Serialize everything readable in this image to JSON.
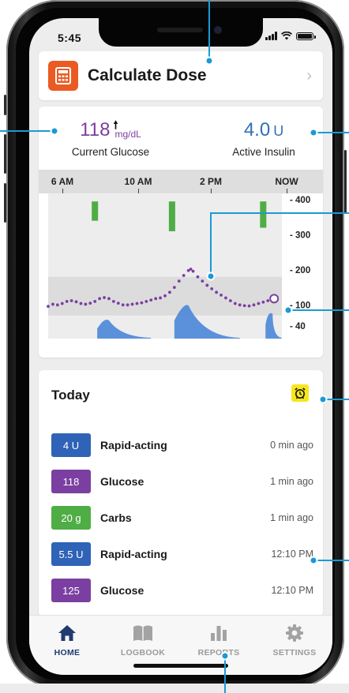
{
  "status_bar": {
    "time": "5:45"
  },
  "dose": {
    "title": "Calculate Dose",
    "icon": "calculator-icon"
  },
  "glucose": {
    "value": "118",
    "unit": "mg/dL",
    "trend": "rising-arrow-icon",
    "label": "Current Glucose"
  },
  "insulin": {
    "value": "4.0",
    "unit": "U",
    "label": "Active Insulin"
  },
  "chart_data": {
    "type": "line",
    "x_labels": [
      "6 AM",
      "10 AM",
      "2 PM",
      "NOW"
    ],
    "y_ticks": [
      "400",
      "300",
      "200",
      "100",
      "40"
    ],
    "ylim": [
      40,
      400
    ],
    "target_range": [
      70,
      180
    ],
    "glucose_series": [
      [
        0,
        96
      ],
      [
        0.02,
        102
      ],
      [
        0.04,
        100
      ],
      [
        0.06,
        104
      ],
      [
        0.08,
        110
      ],
      [
        0.1,
        112
      ],
      [
        0.12,
        109
      ],
      [
        0.14,
        104
      ],
      [
        0.16,
        102
      ],
      [
        0.18,
        105
      ],
      [
        0.2,
        110
      ],
      [
        0.22,
        118
      ],
      [
        0.24,
        121
      ],
      [
        0.26,
        118
      ],
      [
        0.28,
        110
      ],
      [
        0.3,
        105
      ],
      [
        0.32,
        100
      ],
      [
        0.34,
        100
      ],
      [
        0.36,
        102
      ],
      [
        0.38,
        104
      ],
      [
        0.4,
        106
      ],
      [
        0.42,
        110
      ],
      [
        0.44,
        114
      ],
      [
        0.46,
        118
      ],
      [
        0.48,
        120
      ],
      [
        0.5,
        126
      ],
      [
        0.52,
        136
      ],
      [
        0.54,
        150
      ],
      [
        0.56,
        168
      ],
      [
        0.58,
        184
      ],
      [
        0.6,
        198
      ],
      [
        0.61,
        202
      ],
      [
        0.62,
        196
      ],
      [
        0.64,
        180
      ],
      [
        0.66,
        168
      ],
      [
        0.68,
        156
      ],
      [
        0.7,
        146
      ],
      [
        0.72,
        136
      ],
      [
        0.74,
        128
      ],
      [
        0.76,
        120
      ],
      [
        0.78,
        112
      ],
      [
        0.8,
        104
      ],
      [
        0.82,
        100
      ],
      [
        0.84,
        98
      ],
      [
        0.86,
        97
      ],
      [
        0.88,
        100
      ],
      [
        0.9,
        104
      ],
      [
        0.92,
        108
      ],
      [
        0.94,
        112
      ],
      [
        0.96,
        116
      ]
    ],
    "current_point": [
      0.96,
      118
    ],
    "carb_bars": [
      {
        "x": 0.2,
        "top": 395,
        "bottom": 340
      },
      {
        "x": 0.53,
        "top": 395,
        "bottom": 310
      },
      {
        "x": 0.92,
        "top": 395,
        "bottom": 320
      }
    ],
    "insulin_curves": [
      {
        "start": 0.21,
        "peak": 0.24,
        "end": 0.44,
        "height": 0.55
      },
      {
        "start": 0.54,
        "peak": 0.58,
        "end": 0.82,
        "height": 1.0
      },
      {
        "start": 0.93,
        "peak": 0.94,
        "end": 1.0,
        "height": 0.75
      }
    ],
    "colors": {
      "glucose": "#7b3fa1",
      "carbs": "#4fad45",
      "insulin": "#4a86d8",
      "target_band": "#dcdcdc",
      "plot_bg": "#ededed"
    }
  },
  "today": {
    "title": "Today",
    "alarm_icon": "alarm-clock-icon",
    "entries": [
      {
        "badge": "4 U",
        "color": "#2f63b8",
        "name": "Rapid-acting",
        "time": "0 min ago"
      },
      {
        "badge": "118",
        "color": "#7b3fa1",
        "name": "Glucose",
        "time": "1 min ago"
      },
      {
        "badge": "20 g",
        "color": "#4fad45",
        "name": "Carbs",
        "time": "1 min ago"
      },
      {
        "badge": "5.5 U",
        "color": "#2f63b8",
        "name": "Rapid-acting",
        "time": "12:10 PM"
      },
      {
        "badge": "125",
        "color": "#7b3fa1",
        "name": "Glucose",
        "time": "12:10 PM"
      }
    ]
  },
  "tabs": [
    {
      "label": "HOME",
      "icon": "home-icon",
      "active": true
    },
    {
      "label": "LOGBOOK",
      "icon": "book-icon",
      "active": false
    },
    {
      "label": "REPORTS",
      "icon": "bar-chart-icon",
      "active": false
    },
    {
      "label": "SETTINGS",
      "icon": "gear-icon",
      "active": false
    }
  ],
  "accent_color": "#1a9ad6"
}
